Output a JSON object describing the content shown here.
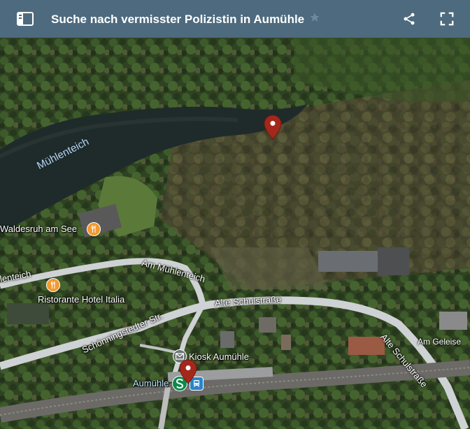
{
  "header": {
    "title": "Suche nach vermisster Polizistin in Aumühle",
    "sidebar_icon": "sidebar-toggle-icon",
    "star_icon": "star-icon",
    "share_icon": "share-icon",
    "fullscreen_icon": "fullscreen-icon",
    "bg_color": "#4e6a7e"
  },
  "map": {
    "water_labels": {
      "muehlenteich": "Mühlenteich"
    },
    "places": {
      "waldesruh": "Waldesruh am See",
      "italia": "Ristorante Hotel Italia",
      "kiosk": "Kiosk Aumühle",
      "aumuehle": "Aumühle"
    },
    "streets": {
      "am_muehlenteich": "Am Mühlenteich",
      "muehlenteich_left": "lenteich",
      "alte_schulstrasse_1": "Alte Schulstraße",
      "alte_schulstrasse_2": "Alte Schulstraße",
      "schoenningstedter": "Schönningstedter Str.",
      "am_geleise": "Am Geleise"
    },
    "marker_color": "#a3281b",
    "poi_color": "#f39a2f",
    "transit_color": "#0d8a4a"
  }
}
